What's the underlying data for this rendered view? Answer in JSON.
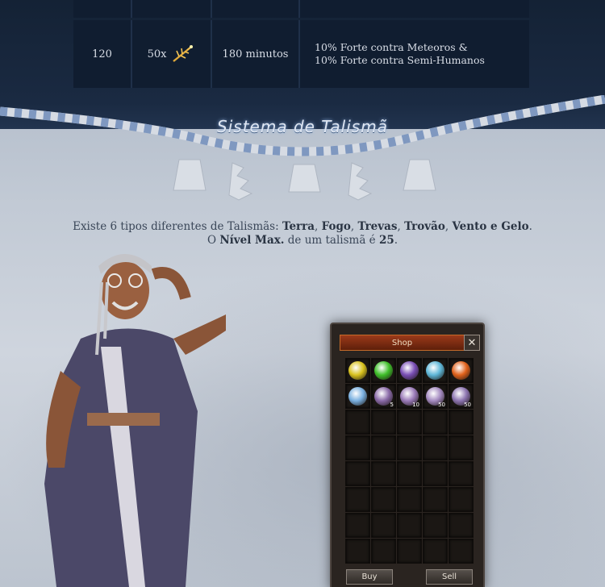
{
  "table": {
    "row": {
      "level": "120",
      "quantity": "50x",
      "duration": "180 minutos",
      "effect_line1": "10% Forte contra Meteoros  &",
      "effect_line2": "10% Forte contra Semi-Humanos"
    },
    "item_icon": "golden-branch-icon"
  },
  "section": {
    "title": "Sistema de Talismã"
  },
  "intro": {
    "text1": "Existe 6 tipos diferentes de Talismãs: ",
    "terra": "Terra",
    "sep1": ", ",
    "fogo": "Fogo",
    "sep2": ", ",
    "trevas": "Trevas",
    "sep3": ", ",
    "trovao": "Trovão",
    "sep4": ", ",
    "vento": "Vento",
    "and": " e ",
    "gelo": "Gelo",
    "period1": ".",
    "text2": "O ",
    "nivel_max": "Nível Max.",
    "text3": " de um talismã é ",
    "level": "25",
    "period2": "."
  },
  "shop": {
    "title": "Shop",
    "close_icon": "close-icon",
    "buy_label": "Buy",
    "sell_label": "Sell",
    "items": [
      {
        "name": "talisma-terra-icon",
        "color": "#d8c21e",
        "qty": ""
      },
      {
        "name": "talisma-vento-icon",
        "color": "#3fbf2a",
        "qty": ""
      },
      {
        "name": "talisma-trevas-icon",
        "color": "#7a4fb5",
        "qty": ""
      },
      {
        "name": "talisma-gelo-icon",
        "color": "#5fb7d8",
        "qty": ""
      },
      {
        "name": "talisma-fogo-icon",
        "color": "#e0621c",
        "qty": ""
      },
      {
        "name": "talisma-gelo-alt-icon",
        "color": "#7ab0e0",
        "qty": ""
      },
      {
        "name": "stone-pack-icon",
        "color": "#8a6aa8",
        "qty": "5"
      },
      {
        "name": "stone-pack-icon",
        "color": "#9a7ab8",
        "qty": "10"
      },
      {
        "name": "stone-pack-icon",
        "color": "#a48ac0",
        "qty": "50"
      },
      {
        "name": "stone-pack-icon",
        "color": "#8c74b0",
        "qty": "50"
      }
    ]
  },
  "character": {
    "name": "sage-npc-illustration"
  }
}
